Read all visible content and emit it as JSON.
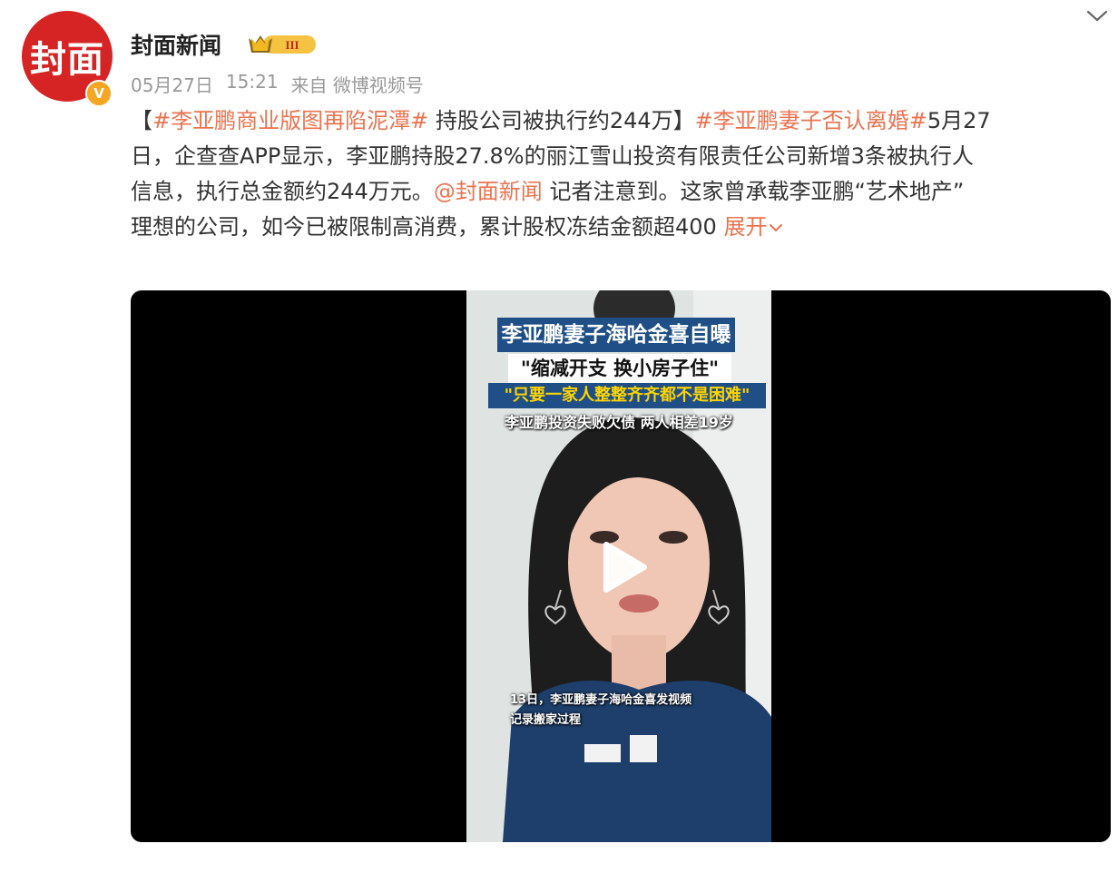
{
  "account": {
    "avatar_text": "封面",
    "verified_mark": "V",
    "name": "封面新闻",
    "level_badge": "III"
  },
  "meta": {
    "date": "05月27日",
    "time": "15:21",
    "source": "来自 微博视频号"
  },
  "post": {
    "l1_b1": "【",
    "l1_tag1": "#李亚鹏商业版图再陷泥潭#",
    "l1_t2": " 持股公司被执行约244万】",
    "l1_tag2": "#李亚鹏妻子否认离婚#",
    "l1_t3": "5月27",
    "l2": "日，企查查APP显示，李亚鹏持股27.8%的丽江雪山投资有限责任公司新增3条被执行人",
    "l3_t1": "信息，执行总金额约244万元。",
    "l3_mention": "@封面新闻",
    "l3_t2": " 记者注意到。这家曾承载李亚鹏“艺术地产”",
    "l4_t1": "理想的公司，如今已被限制高消费，累计股权冻结金额超400 ",
    "expand": "展开"
  },
  "video": {
    "caption1": "李亚鹏妻子海哈金喜自曝",
    "caption2": "\"缩减开支 换小房子住\"",
    "caption3": "\"只要一家人整整齐齐都不是困难\"",
    "caption4": "李亚鹏投资失败欠债 两人相差19岁",
    "subtitle1": "13日，李亚鹏妻子海哈金喜发视频",
    "subtitle2": "记录搬家过程"
  },
  "colors": {
    "accent": "#eb7350",
    "brand_red": "#d62424",
    "badge_gold": "#f5a623"
  },
  "icons": [
    "chevron-down-icon",
    "crown-icon",
    "play-icon",
    "verified-icon"
  ]
}
